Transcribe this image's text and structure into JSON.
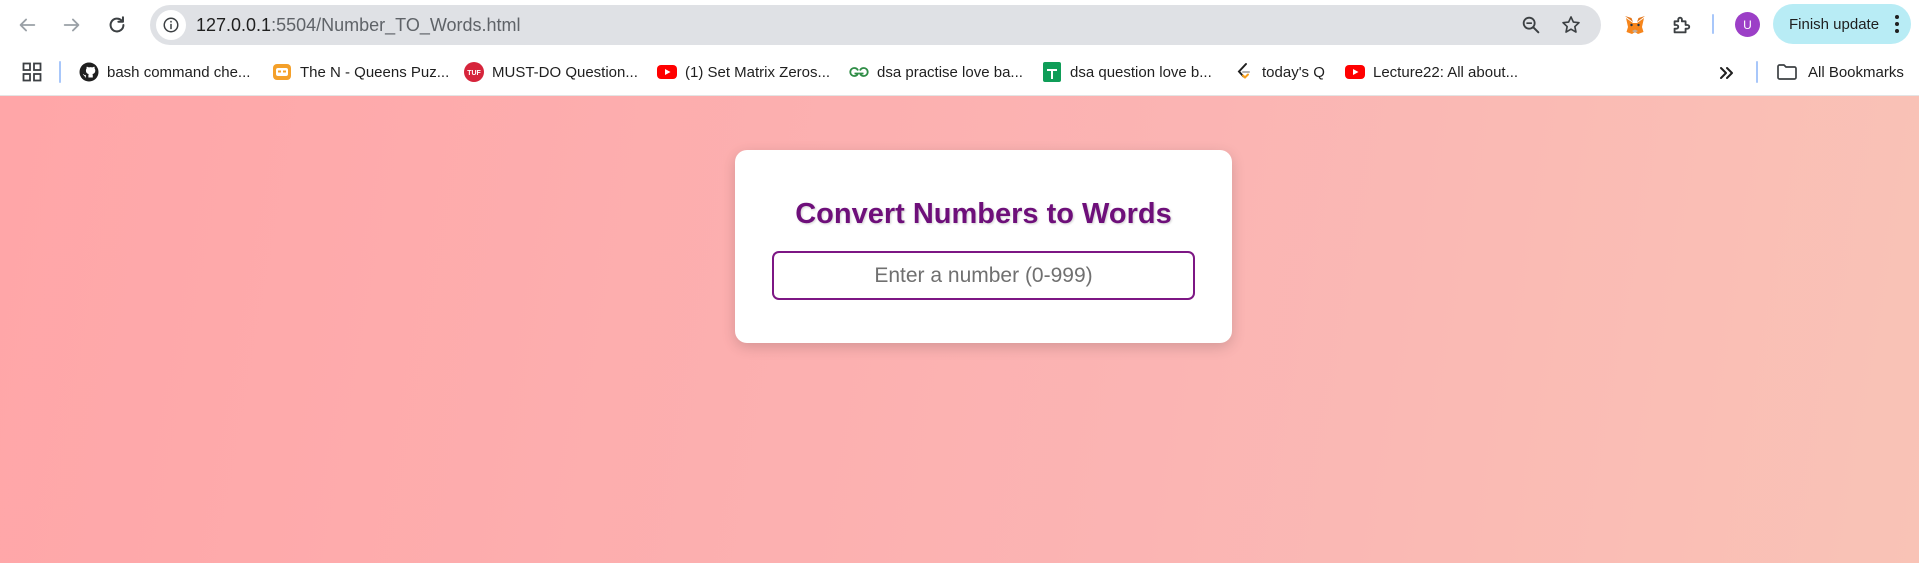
{
  "browser": {
    "url_host": "127.0.0.1",
    "url_rest": ":5504/Number_TO_Words.html",
    "avatar_initial": "U",
    "finish_update_label": "Finish update"
  },
  "bookmarks": {
    "items": [
      {
        "label": "bash command che...",
        "icon": "github-icon"
      },
      {
        "label": "The N - Queens Puz...",
        "icon": "codeium-icon"
      },
      {
        "label": "MUST-DO Question...",
        "icon": "tuf-icon"
      },
      {
        "label": "(1) Set Matrix Zeros...",
        "icon": "youtube-icon"
      },
      {
        "label": "dsa practise love ba...",
        "icon": "geeksforgeeks-icon"
      },
      {
        "label": "dsa question love b...",
        "icon": "google-sheets-icon"
      },
      {
        "label": "today's Q",
        "icon": "leetcode-icon"
      },
      {
        "label": "Lecture22: All about...",
        "icon": "youtube-icon"
      }
    ],
    "all_bookmarks_label": "All Bookmarks"
  },
  "converter": {
    "title": "Convert Numbers to Words",
    "input_placeholder": "Enter a number (0-999)",
    "input_value": ""
  },
  "colors": {
    "title": "#6e0f7a",
    "input_border": "#7d1784",
    "background_start": "#ffa6a8",
    "background_end": "#f9c3b6",
    "finish_update_bg": "#b8ecf5"
  }
}
